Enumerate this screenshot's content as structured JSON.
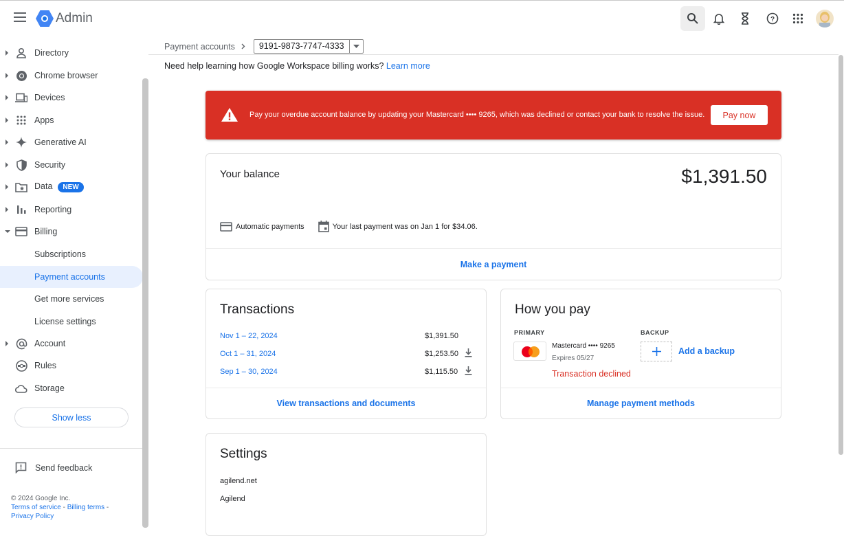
{
  "app": {
    "title": "Admin"
  },
  "sidebar": {
    "items": [
      {
        "label": "Directory",
        "icon": "person-icon"
      },
      {
        "label": "Chrome browser",
        "icon": "chrome-icon"
      },
      {
        "label": "Devices",
        "icon": "devices-icon"
      },
      {
        "label": "Apps",
        "icon": "apps-icon"
      },
      {
        "label": "Generative AI",
        "icon": "sparkle-icon"
      },
      {
        "label": "Security",
        "icon": "shield-icon"
      },
      {
        "label": "Data",
        "icon": "folder-star-icon",
        "badge": "NEW"
      },
      {
        "label": "Reporting",
        "icon": "bar-chart-icon"
      },
      {
        "label": "Billing",
        "icon": "credit-card-icon"
      },
      {
        "label": "Account",
        "icon": "at-icon"
      },
      {
        "label": "Rules",
        "icon": "rules-icon"
      },
      {
        "label": "Storage",
        "icon": "cloud-icon"
      }
    ],
    "billing_sub": [
      "Subscriptions",
      "Payment accounts",
      "Get more services",
      "License settings"
    ],
    "show_less": "Show less",
    "feedback": "Send feedback",
    "footer": {
      "copyright": "© 2024 Google Inc.",
      "terms": "Terms of service",
      "billing_terms": "Billing terms",
      "privacy": "Privacy Policy"
    }
  },
  "breadcrumb": {
    "parent": "Payment accounts",
    "account": "9191-9873-7747-4333"
  },
  "help": {
    "text": "Need help learning how Google Workspace billing works?",
    "link": "Learn more"
  },
  "alert": {
    "message": "Pay your overdue account balance by updating your Mastercard •••• 9265, which was declined or contact your bank to resolve the issue.",
    "button": "Pay now"
  },
  "balance": {
    "title": "Your balance",
    "amount": "$1,391.50",
    "auto_payments": "Automatic payments",
    "last_payment": "Your last payment was on Jan 1 for $34.06.",
    "make_payment": "Make a payment"
  },
  "transactions": {
    "title": "Transactions",
    "rows": [
      {
        "period": "Nov 1 – 22, 2024",
        "amount": "$1,391.50"
      },
      {
        "period": "Oct 1 – 31, 2024",
        "amount": "$1,253.50"
      },
      {
        "period": "Sep 1 – 30, 2024",
        "amount": "$1,115.50"
      }
    ],
    "view_link": "View transactions and documents"
  },
  "how_you_pay": {
    "title": "How you pay",
    "primary_label": "PRIMARY",
    "backup_label": "BACKUP",
    "card_name": "Mastercard •••• 9265",
    "card_expiry": "Expires 05/27",
    "card_status": "Transaction declined",
    "add_backup": "Add a backup",
    "manage": "Manage payment methods"
  },
  "settings": {
    "title": "Settings",
    "domain": "agilend.net",
    "org": "Agilend"
  },
  "colors": {
    "accent": "#1a73e8",
    "alert": "#d93025",
    "selected_bg": "#e8f0fe"
  }
}
